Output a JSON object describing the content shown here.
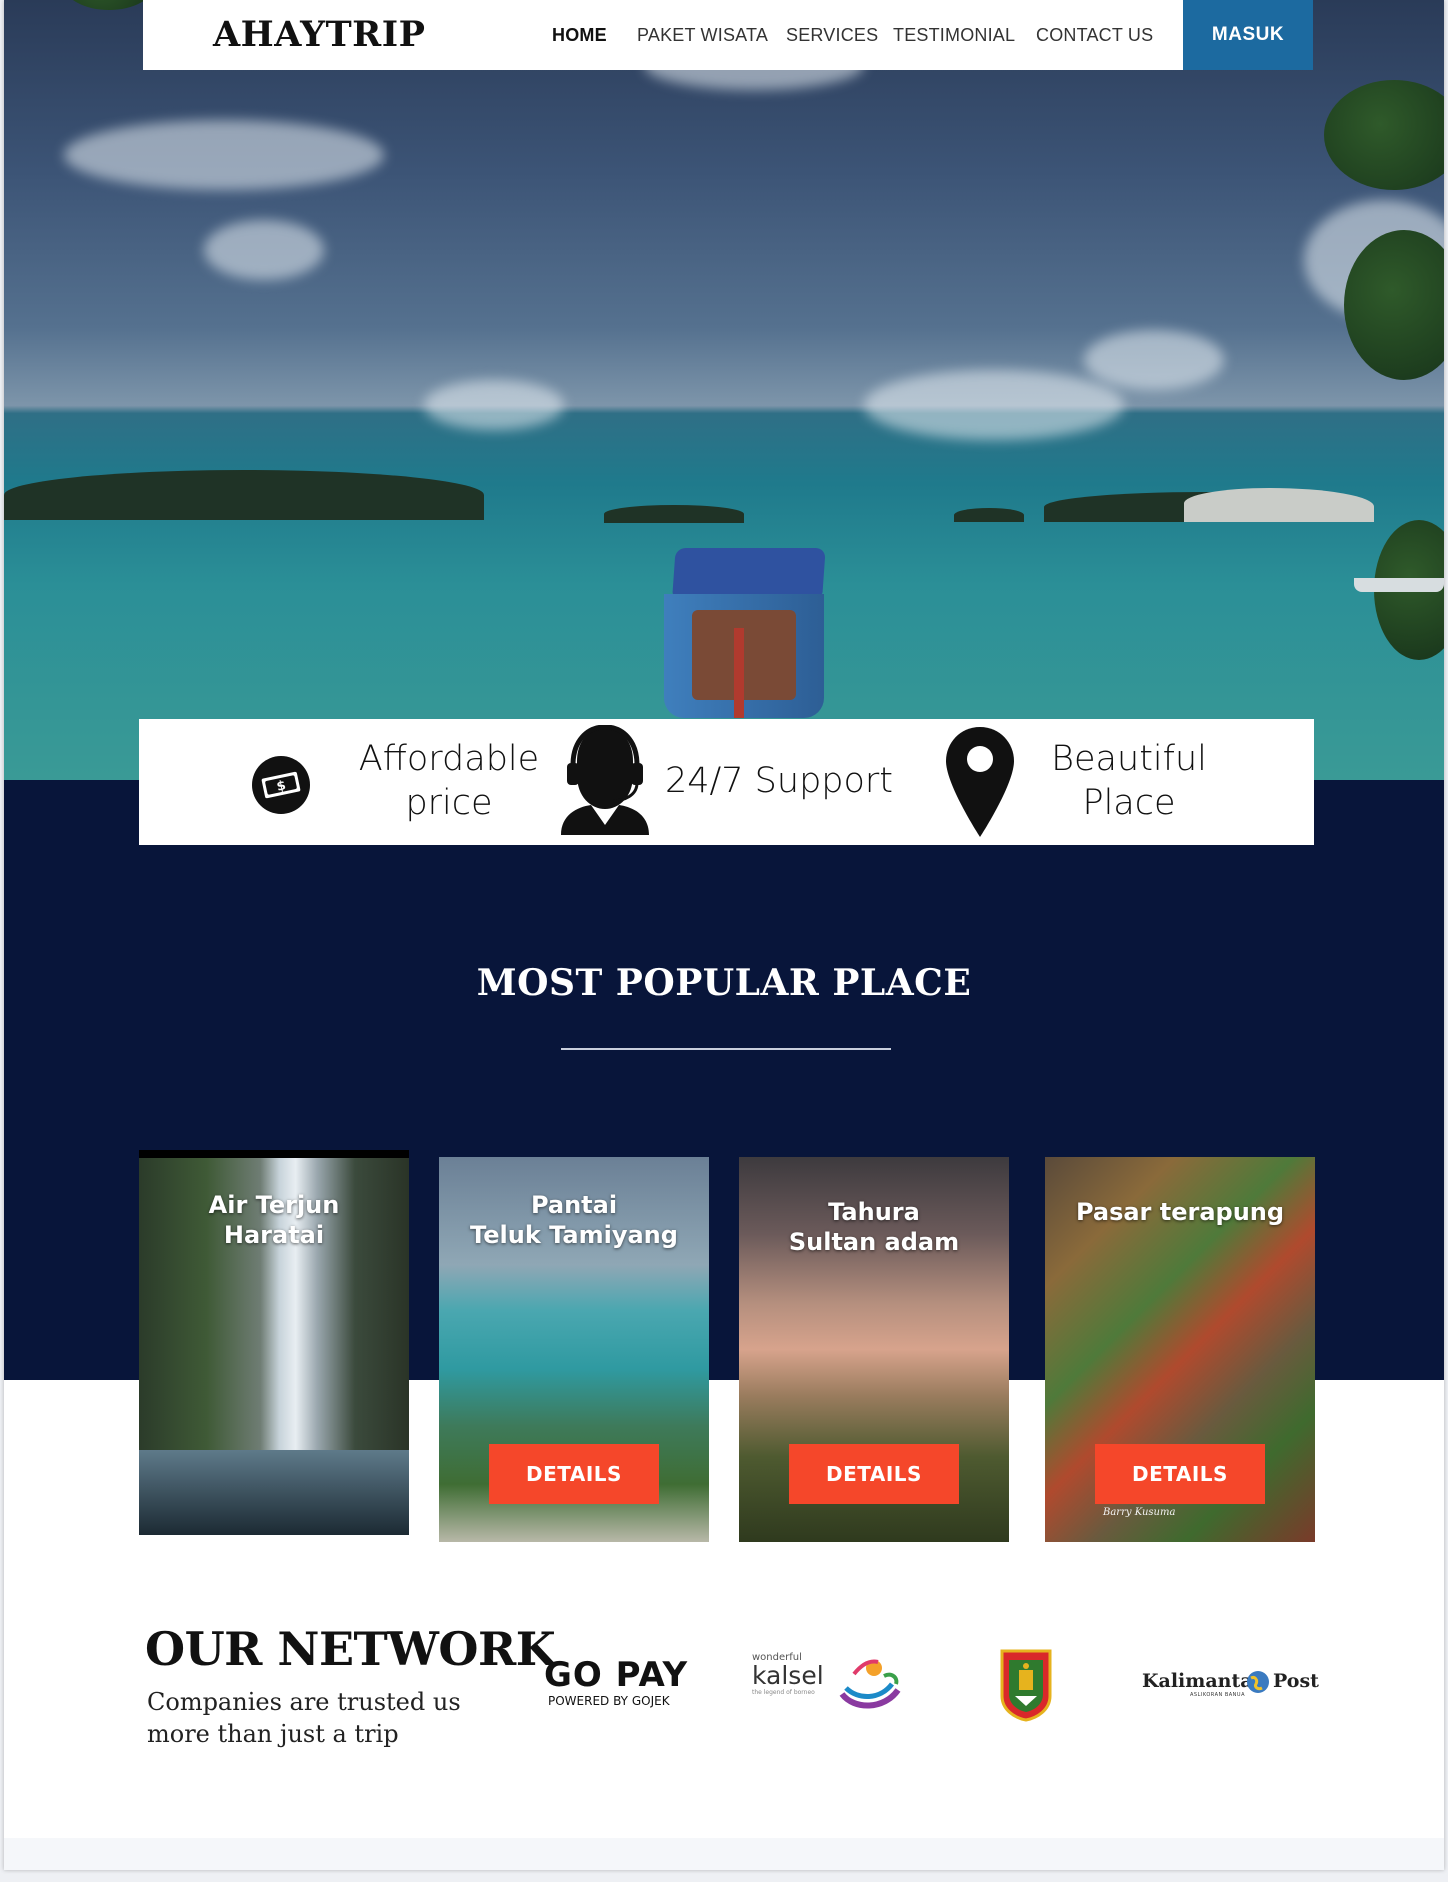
{
  "nav": {
    "logo": "AHAYTRIP",
    "links": [
      "HOME",
      "PAKET WISATA",
      "SERVICES",
      "TESTIMONIAL",
      "CONTACT US"
    ],
    "login_label": "MASUK",
    "accent_color": "#1c6aa0"
  },
  "features": [
    {
      "icon": "money-icon",
      "label": "Affordable price"
    },
    {
      "icon": "support-agent-icon",
      "label": "24/7 Support"
    },
    {
      "icon": "location-pin-icon",
      "label": "Beautiful Place"
    }
  ],
  "popular": {
    "title": "MOST POPULAR PLACE",
    "cards": [
      {
        "title_line1": "Air Terjun",
        "title_line2": "Haratai"
      },
      {
        "title_line1": "Pantai",
        "title_line2": "Teluk Tamiyang",
        "button": "DETAILS"
      },
      {
        "title_line1": "Tahura",
        "title_line2": "Sultan adam",
        "button": "DETAILS"
      },
      {
        "title_line1": "Pasar terapung",
        "title_line2": "",
        "button": "DETAILS",
        "photo_credit": "Barry Kusuma"
      }
    ],
    "button_color": "#f5472a",
    "background_color": "#08153a"
  },
  "network": {
    "title": "OUR NETWORK",
    "subtitle_line1": "Companies are trusted us",
    "subtitle_line2": "more than just a trip",
    "partners": [
      {
        "name": "gopay",
        "text_main": "GO PAY",
        "text_sub": "POWERED BY GOJEK"
      },
      {
        "name": "wonderful-kalsel",
        "text_small": "wonderful",
        "text_main": "kalsel",
        "text_tag": "the legend of borneo"
      },
      {
        "name": "kalsel-emblem"
      },
      {
        "name": "kalimantan-post",
        "text_main": "Kalimantan Post",
        "text_tag": "ASLIKORAN BANUA"
      }
    ]
  }
}
